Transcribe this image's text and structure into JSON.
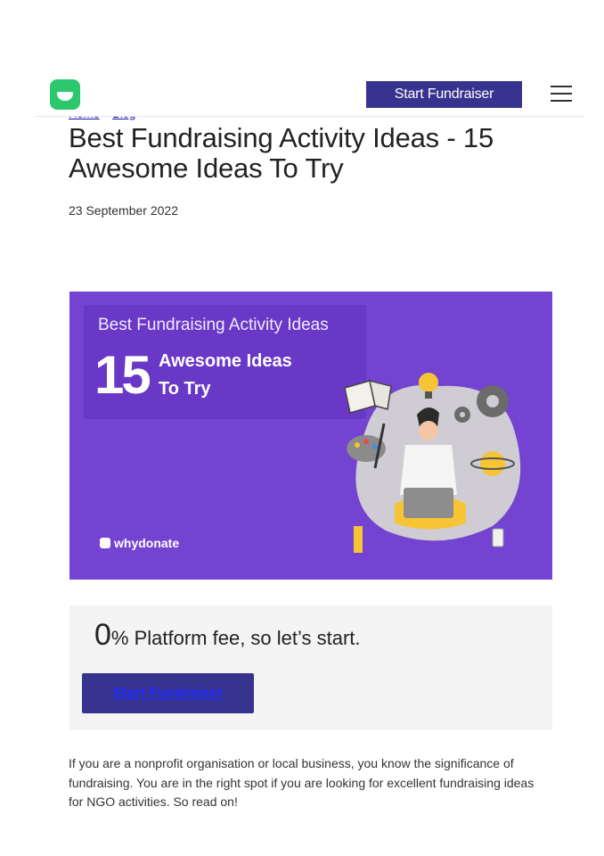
{
  "header": {
    "cta_label": "Start Fundraiser"
  },
  "breadcrumb": {
    "home": "Home",
    "separator": "»",
    "blog": "Blog"
  },
  "article": {
    "title": "Best Fundraising Activity Ideas -  15 Awesome Ideas To Try",
    "date": "23 September 2022"
  },
  "hero": {
    "line1": "Best Fundraising Activity Ideas",
    "number": "15",
    "line2": "Awesome Ideas",
    "line3": "To Try",
    "brand": "whydonate"
  },
  "fee_box": {
    "zero": "0",
    "text": "% Platform fee, so let’s start.",
    "button_label": "Start Fundraiser"
  },
  "intro": "If you are a nonprofit organisation or local business, you know the significance of fundraising. You are in the right spot if you are looking for excellent fundraising ideas for NGO activities. So read on!",
  "colors": {
    "brand_green": "#2dc76d",
    "primary_button": "#37348f",
    "hero_purple": "#7443d1"
  },
  "icons": [
    "logo-icon",
    "hamburger-menu-icon"
  ]
}
